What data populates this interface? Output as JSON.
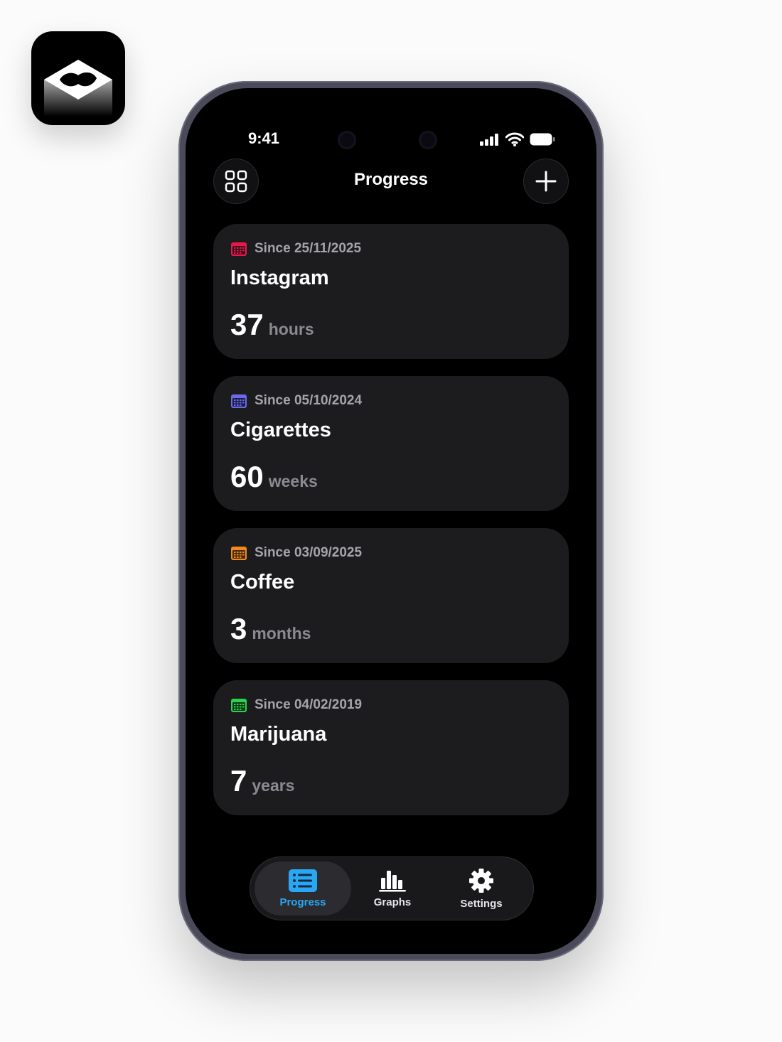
{
  "status_bar": {
    "time": "9:41"
  },
  "header": {
    "title": "Progress"
  },
  "colors": {
    "instagram": "#e8184f",
    "cigarettes": "#6b6bea",
    "coffee": "#f08a1e",
    "marijuana": "#2fcf4f",
    "tab_active": "#2aa7f3"
  },
  "cards": [
    {
      "since": "Since 25/11/2025",
      "title": "Instagram",
      "value": "37",
      "unit": "hours"
    },
    {
      "since": "Since 05/10/2024",
      "title": "Cigarettes",
      "value": "60",
      "unit": "weeks"
    },
    {
      "since": "Since 03/09/2025",
      "title": "Coffee",
      "value": "3",
      "unit": "months"
    },
    {
      "since": "Since 04/02/2019",
      "title": "Marijuana",
      "value": "7",
      "unit": "years"
    }
  ],
  "tabs": [
    {
      "label": "Progress",
      "icon": "list-icon",
      "active": true
    },
    {
      "label": "Graphs",
      "icon": "bar-chart-icon",
      "active": false
    },
    {
      "label": "Settings",
      "icon": "gear-icon",
      "active": false
    }
  ]
}
